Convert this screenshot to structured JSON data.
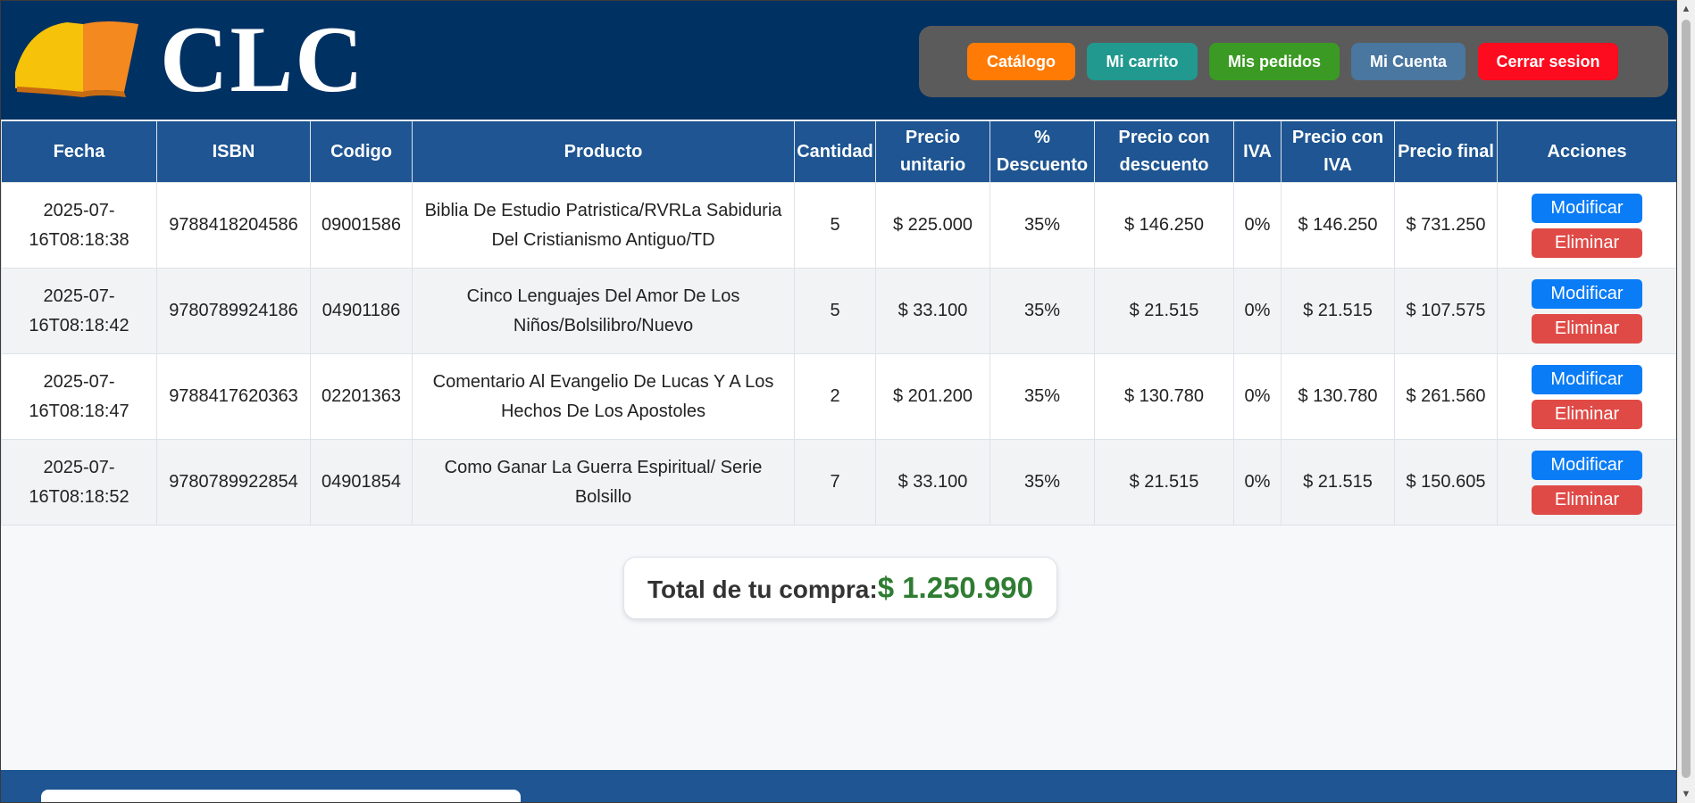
{
  "brand": {
    "logo_text": "CLC"
  },
  "nav": [
    {
      "label": "Catálogo",
      "color": "#ff7b05"
    },
    {
      "label": "Mi carrito",
      "color": "#21998e"
    },
    {
      "label": "Mis pedidos",
      "color": "#3b9a23"
    },
    {
      "label": "Mi Cuenta",
      "color": "#4977a0"
    },
    {
      "label": "Cerrar sesion",
      "color": "#fd0b1e"
    }
  ],
  "table": {
    "headers": [
      "Fecha",
      "ISBN",
      "Codigo",
      "Producto",
      "Cantidad",
      "Precio unitario",
      "% Descuento",
      "Precio con descuento",
      "IVA",
      "Precio con IVA",
      "Precio final",
      "Acciones"
    ],
    "rows": [
      {
        "fecha": "2025-07-16T08:18:38",
        "isbn": "9788418204586",
        "codigo": "09001586",
        "producto": "Biblia De Estudio Patristica/RVRLa Sabiduria Del Cristianismo Antiguo/TD",
        "cantidad": "5",
        "precio_unitario": "$ 225.000",
        "descuento": "35%",
        "precio_descuento": "$ 146.250",
        "iva": "0%",
        "precio_iva": "$ 146.250",
        "precio_final": "$ 731.250"
      },
      {
        "fecha": "2025-07-16T08:18:42",
        "isbn": "9780789924186",
        "codigo": "04901186",
        "producto": "Cinco Lenguajes Del Amor De Los Niños/Bolsilibro/Nuevo",
        "cantidad": "5",
        "precio_unitario": "$ 33.100",
        "descuento": "35%",
        "precio_descuento": "$ 21.515",
        "iva": "0%",
        "precio_iva": "$ 21.515",
        "precio_final": "$ 107.575"
      },
      {
        "fecha": "2025-07-16T08:18:47",
        "isbn": "9788417620363",
        "codigo": "02201363",
        "producto": "Comentario Al Evangelio De Lucas Y A Los Hechos De Los Apostoles",
        "cantidad": "2",
        "precio_unitario": "$ 201.200",
        "descuento": "35%",
        "precio_descuento": "$ 130.780",
        "iva": "0%",
        "precio_iva": "$ 130.780",
        "precio_final": "$ 261.560"
      },
      {
        "fecha": "2025-07-16T08:18:52",
        "isbn": "9780789922854",
        "codigo": "04901854",
        "producto": "Como Ganar La Guerra Espiritual/ Serie Bolsillo",
        "cantidad": "7",
        "precio_unitario": "$ 33.100",
        "descuento": "35%",
        "precio_descuento": "$ 21.515",
        "iva": "0%",
        "precio_iva": "$ 21.515",
        "precio_final": "$ 150.605"
      }
    ],
    "actions": {
      "modify": "Modificar",
      "delete": "Eliminar"
    }
  },
  "total": {
    "label": "Total de tu compra:",
    "value": "$ 1.250.990"
  },
  "icons": {
    "logo": "open-book-icon",
    "scroll_up": "arrow-up-icon",
    "scroll_down": "arrow-down-icon"
  }
}
